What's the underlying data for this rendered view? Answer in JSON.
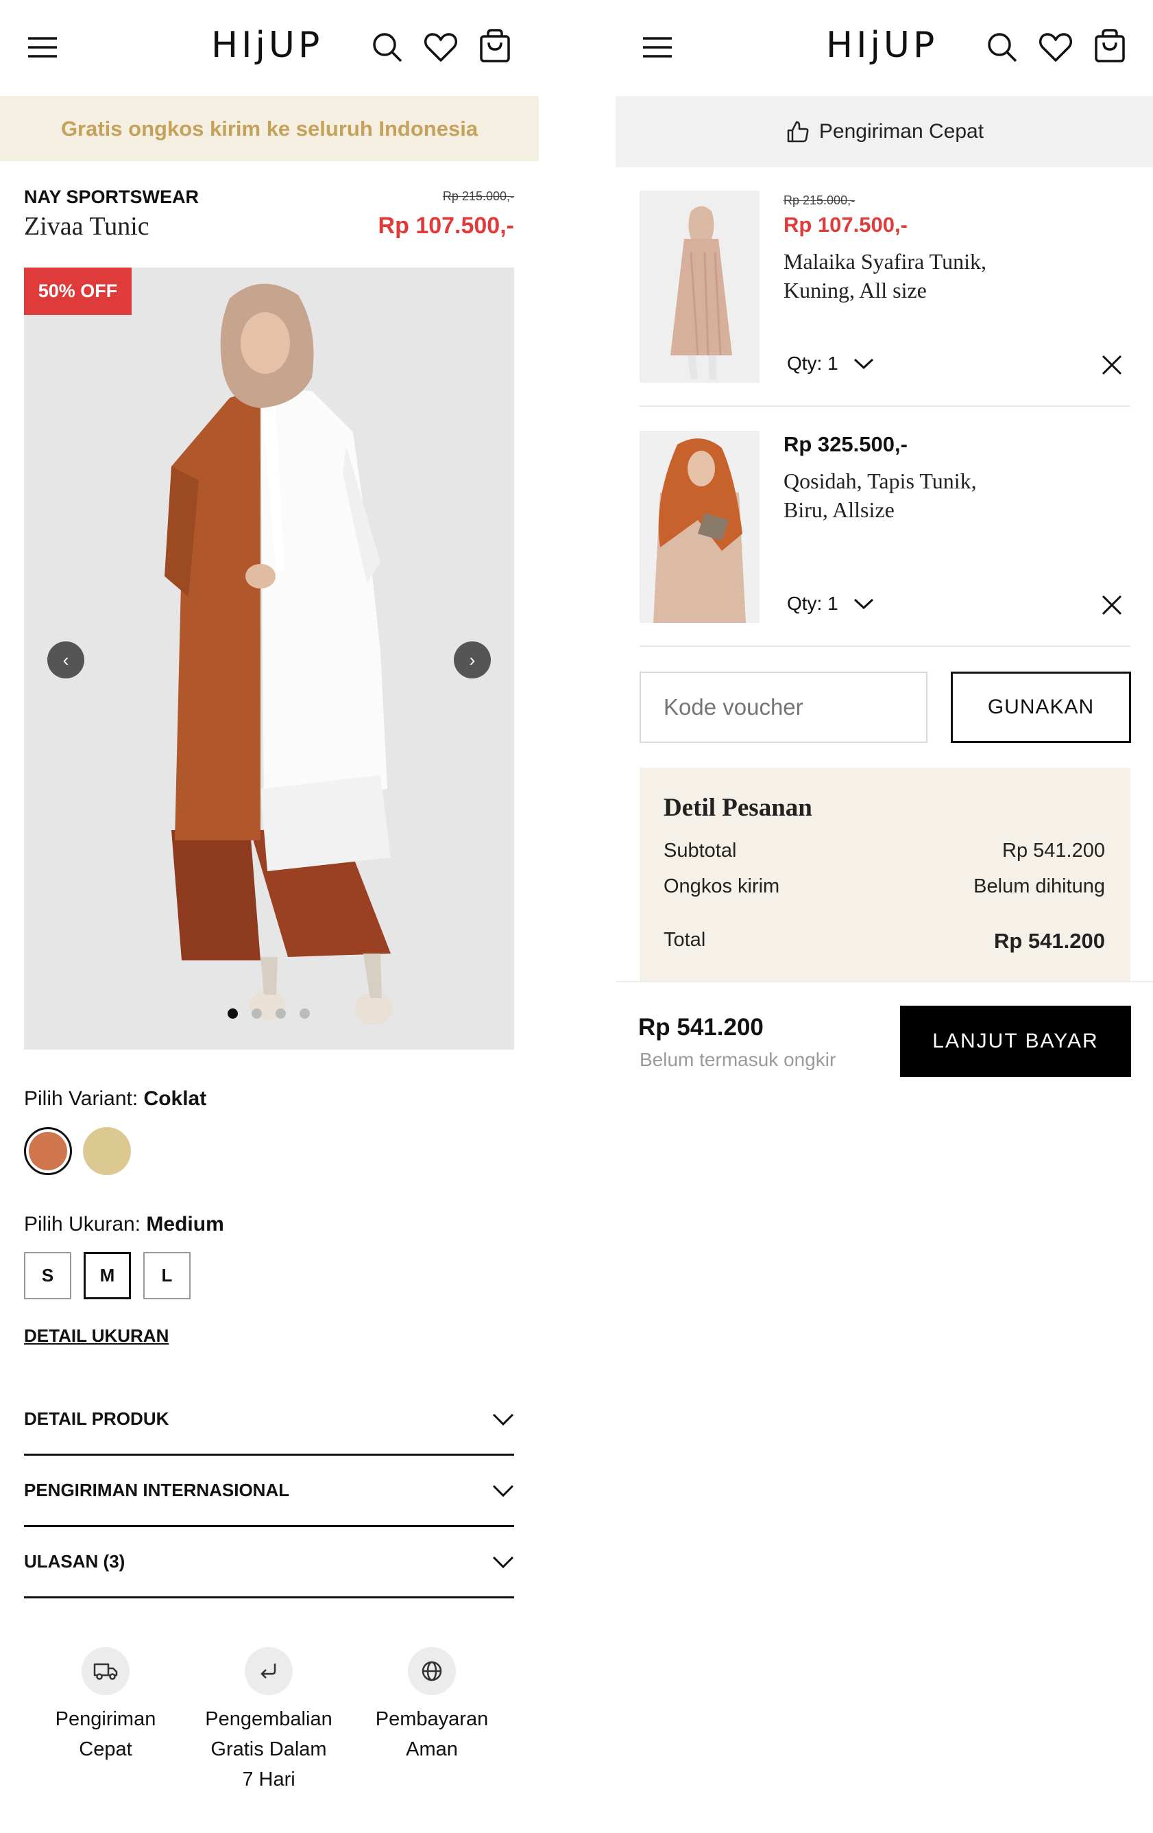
{
  "left": {
    "header": {
      "logo": "HIjUP",
      "menu_icon": "menu-icon",
      "search_icon": "search-icon",
      "wishlist_icon": "heart-icon",
      "cart_icon": "shopping-bag-icon"
    },
    "banner": {
      "text": "Gratis ongkos kirim ke seluruh Indonesia",
      "bg": "#f5efe2",
      "color": "#c5a25c"
    },
    "product": {
      "brand": "NAY SPORTSWEAR",
      "name": "Zivaa Tunic",
      "old_price": "Rp 215.000,-",
      "price": "Rp 107.500,-",
      "discount_badge": "50% OFF",
      "prev_icon": "‹",
      "next_icon": "›",
      "slide_count": 4,
      "active_slide": 1
    },
    "variant": {
      "label": "Pilih Variant:",
      "selected": "Coklat",
      "swatches": [
        "#d0764f",
        "#dcc991"
      ]
    },
    "size": {
      "label": "Pilih Ukuran:",
      "selected": "Medium",
      "options": [
        "S",
        "M",
        "L"
      ],
      "detail_link": "DETAIL UKURAN"
    },
    "accordion": [
      "DETAIL PRODUK",
      "PENGIRIMAN INTERNASIONAL",
      "ULASAN (3)"
    ],
    "features": [
      {
        "icon": "truck-icon",
        "lines": [
          "Pengiriman",
          "Cepat"
        ]
      },
      {
        "icon": "return-icon",
        "lines": [
          "Pengembalian",
          "Gratis Dalam",
          "7 Hari"
        ]
      },
      {
        "icon": "globe-icon",
        "lines": [
          "Pembayaran",
          "Aman"
        ]
      }
    ]
  },
  "right": {
    "header": {
      "logo": "HIjUP"
    },
    "banner": {
      "text": "Pengiriman Cepat",
      "icon": "thumbs-up-icon"
    },
    "items": [
      {
        "old_price": "Rp 215.000,-",
        "price": "Rp 107.500,-",
        "name_line1": "Malaika Syafira Tunik,",
        "name_line2": "Kuning, All size",
        "qty": "Qty: 1"
      },
      {
        "old_price": "",
        "price": "Rp 325.500,-",
        "name_line1": "Qosidah, Tapis Tunik,",
        "name_line2": "Biru, Allsize",
        "qty": "Qty: 1"
      }
    ],
    "voucher": {
      "placeholder": "Kode voucher",
      "button": "GUNAKAN"
    },
    "summary": {
      "title": "Detil Pesanan",
      "subtotal_label": "Subtotal",
      "subtotal_value": "Rp 541.200",
      "shipping_label": "Ongkos kirim",
      "shipping_value": "Belum dihitung",
      "total_label": "Total",
      "total_value": "Rp 541.200"
    },
    "footer": {
      "total": "Rp 541.200",
      "note": "Belum termasuk ongkir",
      "checkout": "LANJUT BAYAR"
    }
  }
}
